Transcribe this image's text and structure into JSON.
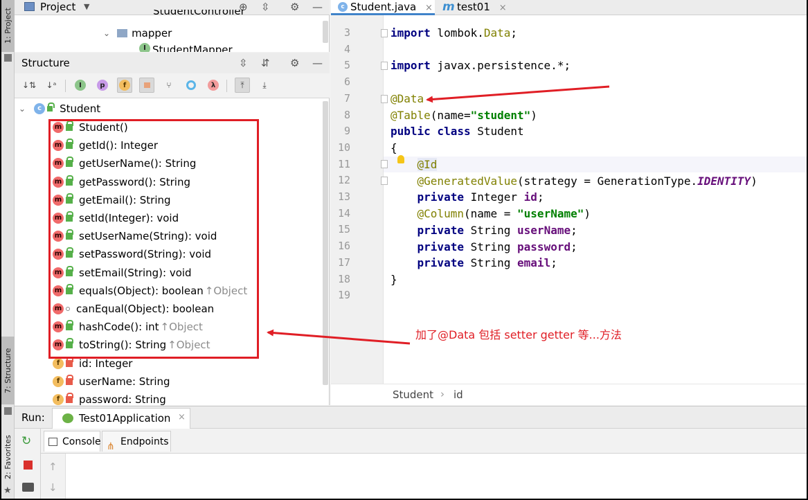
{
  "sidebar_tabs": {
    "project": "1: Project",
    "structure": "7: Structure",
    "favorites": "2: Favorites"
  },
  "project_panel": {
    "title": "Project",
    "cut_row": "StudentController",
    "folder": "mapper",
    "file": "StudentMapper"
  },
  "structure_panel": {
    "title": "Structure",
    "root": "Student",
    "items": [
      {
        "kind": "m",
        "vis": "pub",
        "label": "Student()",
        "inherit": ""
      },
      {
        "kind": "m",
        "vis": "pub",
        "label": "getId(): Integer",
        "inherit": ""
      },
      {
        "kind": "m",
        "vis": "pub",
        "label": "getUserName(): String",
        "inherit": ""
      },
      {
        "kind": "m",
        "vis": "pub",
        "label": "getPassword(): String",
        "inherit": ""
      },
      {
        "kind": "m",
        "vis": "pub",
        "label": "getEmail(): String",
        "inherit": ""
      },
      {
        "kind": "m",
        "vis": "pub",
        "label": "setId(Integer): void",
        "inherit": ""
      },
      {
        "kind": "m",
        "vis": "pub",
        "label": "setUserName(String): void",
        "inherit": ""
      },
      {
        "kind": "m",
        "vis": "pub",
        "label": "setPassword(String): void",
        "inherit": ""
      },
      {
        "kind": "m",
        "vis": "pub",
        "label": "setEmail(String): void",
        "inherit": ""
      },
      {
        "kind": "m",
        "vis": "pub",
        "label": "equals(Object): boolean",
        "inherit": "↑Object"
      },
      {
        "kind": "m",
        "vis": "pkg",
        "label": "canEqual(Object): boolean",
        "inherit": ""
      },
      {
        "kind": "m",
        "vis": "pub",
        "label": "hashCode(): int",
        "inherit": "↑Object"
      },
      {
        "kind": "m",
        "vis": "pub",
        "label": "toString(): String",
        "inherit": "↑Object"
      },
      {
        "kind": "f",
        "vis": "priv",
        "label": "id: Integer",
        "inherit": ""
      },
      {
        "kind": "f",
        "vis": "priv",
        "label": "userName: String",
        "inherit": ""
      },
      {
        "kind": "f",
        "vis": "priv",
        "label": "password: String",
        "inherit": ""
      }
    ]
  },
  "editor": {
    "tabs": [
      "Student.java",
      "test01"
    ],
    "line_numbers": [
      "3",
      "4",
      "5",
      "6",
      "7",
      "8",
      "9",
      "10",
      "11",
      "12",
      "13",
      "14",
      "15",
      "16",
      "17",
      "18",
      "19"
    ],
    "breadcrumb": [
      "Student",
      "id"
    ]
  },
  "annotation": {
    "text": "加了@Data 包括 setter getter 等...方法",
    "color": "#e01e25"
  },
  "run_panel": {
    "label": "Run:",
    "config": "Test01Application",
    "tabs": [
      "Console",
      "Endpoints"
    ]
  }
}
